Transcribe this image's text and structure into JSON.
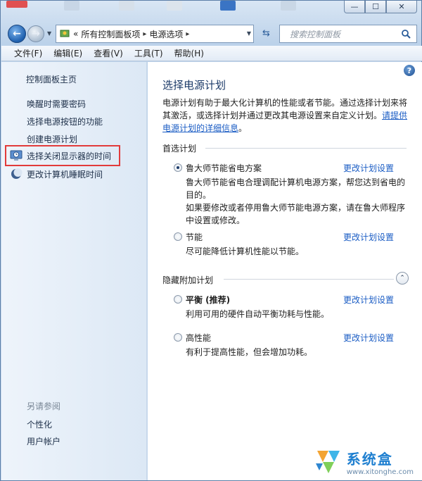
{
  "window": {
    "controls": {
      "minimize": "—",
      "maximize": "☐",
      "close": "✕"
    }
  },
  "address_bar": {
    "recent_marker": "«",
    "crumbs": [
      "所有控制面板项",
      "电源选项"
    ],
    "crumb_sep": "▸",
    "search_placeholder": "搜索控制面板"
  },
  "menu": [
    "文件(F)",
    "编辑(E)",
    "查看(V)",
    "工具(T)",
    "帮助(H)"
  ],
  "sidebar": {
    "home": "控制面板主页",
    "links": [
      "唤醒时需要密码",
      "选择电源按钮的功能",
      "创建电源计划"
    ],
    "icon_links": [
      "选择关闭显示器的时间",
      "更改计算机睡眠时间"
    ],
    "see_also_heading": "另请参阅",
    "see_also": [
      "个性化",
      "用户帐户"
    ]
  },
  "content": {
    "help": "?",
    "title": "选择电源计划",
    "intro_text": "电源计划有助于最大化计算机的性能或者节能。通过选择计划来将其激活，或选择计划并通过更改其电源设置来自定义计划。",
    "intro_link": "请提供电源计划的详细信息",
    "intro_end": "。",
    "preferred_heading": "首选计划",
    "hidden_heading": "隐藏附加计划",
    "collapse_glyph": "⌃",
    "change_link": "更改计划设置",
    "plans_preferred": [
      {
        "name": "鲁大师节能省电方案",
        "desc": "鲁大师节能省电合理调配计算机电源方案，帮您达到省电的目的。",
        "desc2": "如果要修改或者停用鲁大师节能电源方案，请在鲁大师程序中设置或修改。",
        "selected": true
      },
      {
        "name": "节能",
        "desc": "尽可能降低计算机性能以节能。",
        "selected": false
      }
    ],
    "plans_hidden": [
      {
        "name": "平衡 (推荐)",
        "desc": "利用可用的硬件自动平衡功耗与性能。",
        "selected": false
      },
      {
        "name": "高性能",
        "desc": "有利于提高性能，但会增加功耗。",
        "selected": false
      }
    ]
  },
  "watermark": {
    "title": "系统盒",
    "url": "www.xitonghe.com"
  },
  "colors": {
    "link": "#1a5cc4",
    "highlight_box": "#e23b3b",
    "title": "#1b3a68"
  }
}
